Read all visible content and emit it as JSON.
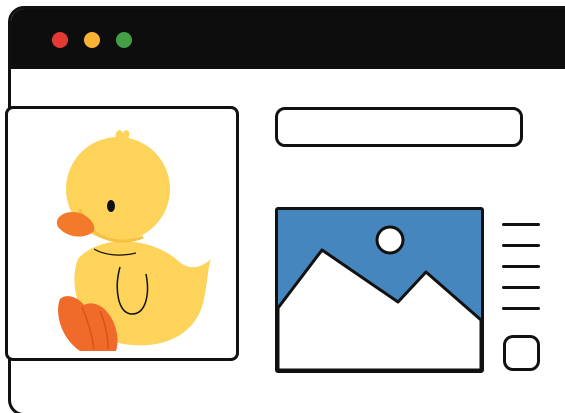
{
  "window": {
    "traffic_lights": [
      {
        "name": "close",
        "color": "#e53935"
      },
      {
        "name": "minimize",
        "color": "#f9b233"
      },
      {
        "name": "maximize",
        "color": "#43a047"
      }
    ]
  },
  "hero": {
    "icon": "duck-illustration",
    "colors": {
      "body": "#fdd35a",
      "beak": "#f47a2b",
      "feet": "#f06b2a"
    }
  },
  "search": {
    "placeholder": ""
  },
  "photo": {
    "icon": "landscape-image-icon",
    "colors": {
      "sky": "#4686bf",
      "mountains": "#ffffff",
      "sun": "#ffffff"
    }
  },
  "text_lines_count": 5,
  "action_button": {
    "icon": "square-button"
  }
}
